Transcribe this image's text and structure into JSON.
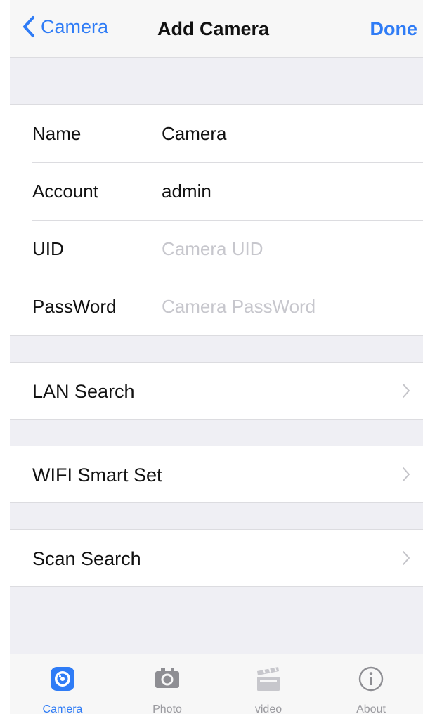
{
  "nav": {
    "back_label": "Camera",
    "title": "Add Camera",
    "done_label": "Done"
  },
  "form": {
    "rows": [
      {
        "label": "Name",
        "value": "Camera",
        "placeholder": ""
      },
      {
        "label": "Account",
        "value": "admin",
        "placeholder": ""
      },
      {
        "label": "UID",
        "value": "",
        "placeholder": "Camera UID"
      },
      {
        "label": "PassWord",
        "value": "",
        "placeholder": "Camera PassWord"
      }
    ]
  },
  "options": [
    {
      "label": "LAN Search",
      "icon": "chevron-right-icon"
    },
    {
      "label": "WIFI Smart Set",
      "icon": "chevron-right-icon"
    },
    {
      "label": "Scan Search",
      "icon": "chevron-right-icon"
    }
  ],
  "tabbar": {
    "tabs": [
      {
        "label": "Camera",
        "icon": "camera-lens-icon",
        "active": true
      },
      {
        "label": "Photo",
        "icon": "photo-camera-icon",
        "active": false
      },
      {
        "label": "video",
        "icon": "clapperboard-icon",
        "active": false
      },
      {
        "label": "About",
        "icon": "info-icon",
        "active": false
      }
    ]
  },
  "colors": {
    "accent": "#2f7cf6",
    "background": "#efeff4",
    "inactive": "#9a9a9f"
  }
}
